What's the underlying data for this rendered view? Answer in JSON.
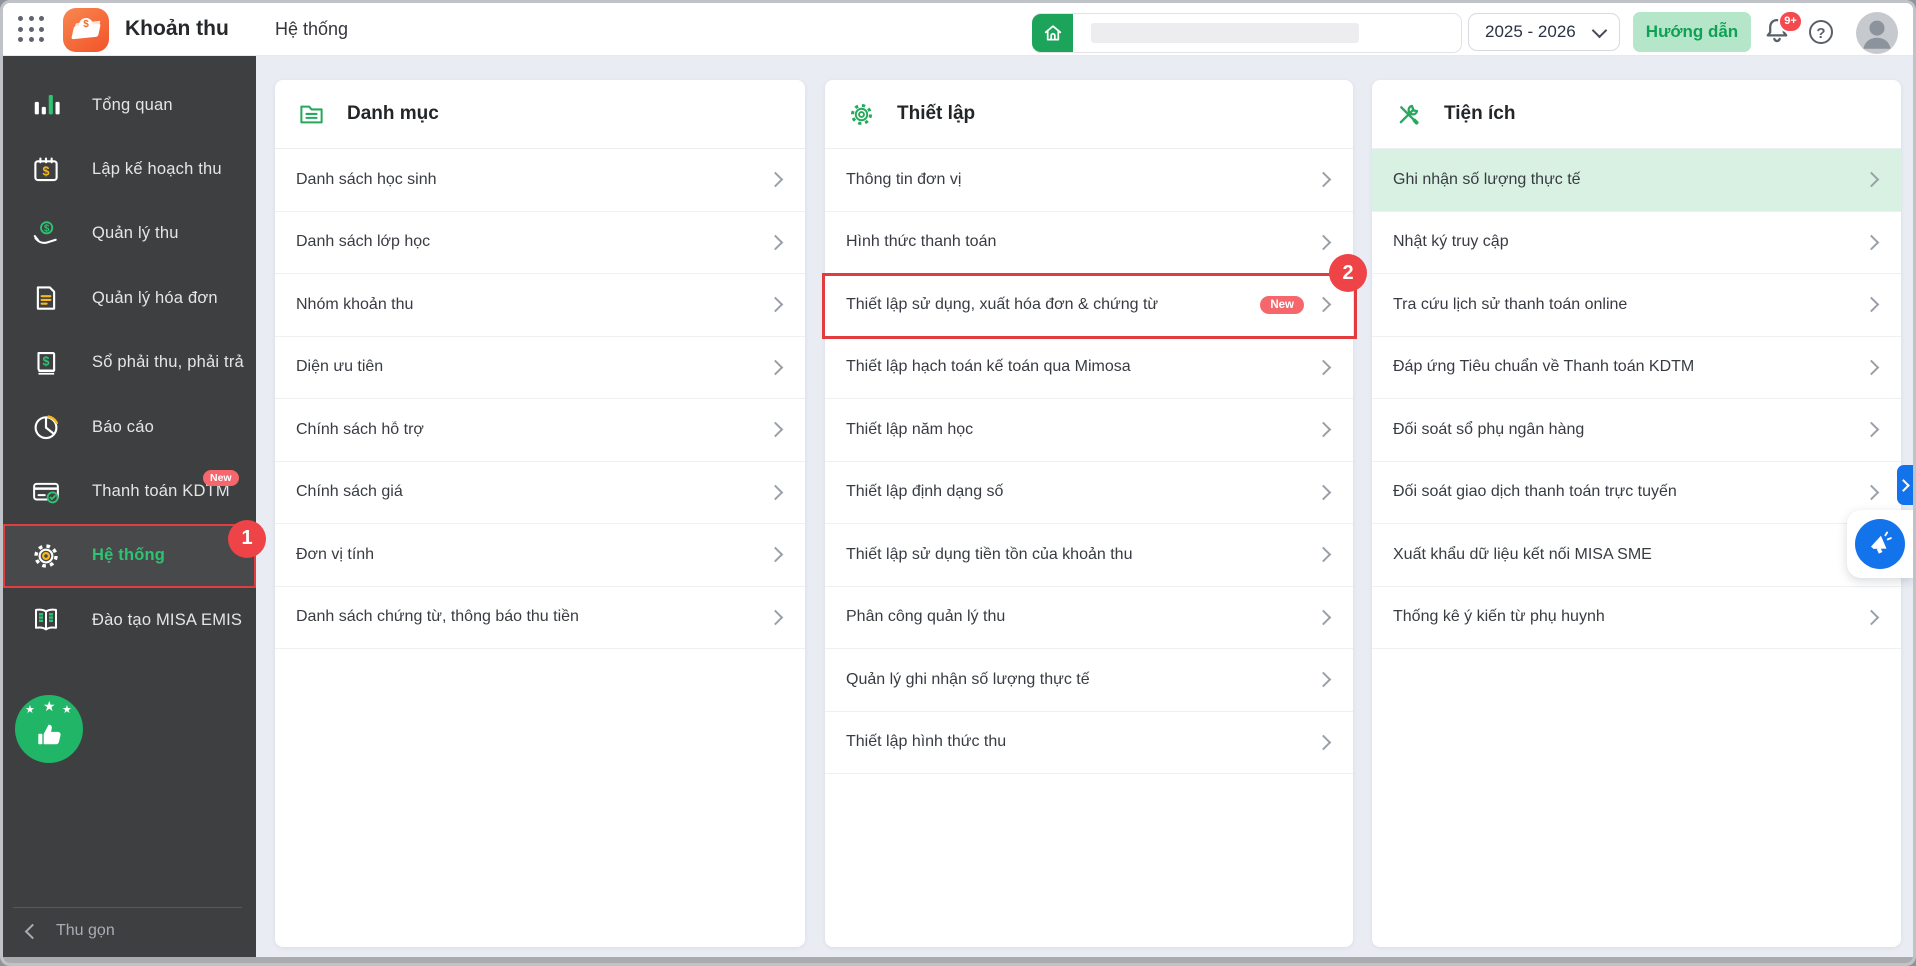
{
  "app": {
    "title": "Khoản thu",
    "breadcrumb": "Hệ thống"
  },
  "topbar": {
    "year_selector": "2025 - 2026",
    "guide_button": "Hướng dẫn",
    "notification_badge": "9+",
    "help_glyph": "?"
  },
  "sidebar": {
    "items": [
      {
        "label": "Tổng quan",
        "icon": "bar-chart-icon"
      },
      {
        "label": "Lập kế hoạch thu",
        "icon": "calendar-dollar-icon"
      },
      {
        "label": "Quản lý thu",
        "icon": "hand-coin-icon"
      },
      {
        "label": "Quản lý hóa đơn",
        "icon": "invoice-icon"
      },
      {
        "label": "Sổ phải thu, phải trả",
        "icon": "ledger-book-icon"
      },
      {
        "label": "Báo cáo",
        "icon": "pie-chart-icon"
      },
      {
        "label": "Thanh toán KDTM",
        "icon": "card-check-icon",
        "badge": "New"
      },
      {
        "label": "Hệ thống",
        "icon": "gear-icon",
        "active": true,
        "step_marker": "1"
      },
      {
        "label": "Đào tạo MISA EMIS",
        "icon": "open-book-icon"
      }
    ],
    "collapse_label": "Thu gọn"
  },
  "cards": [
    {
      "title": "Danh mục",
      "icon": "folder-list-icon",
      "items": [
        {
          "label": "Danh sách học sinh"
        },
        {
          "label": "Danh sách lớp học"
        },
        {
          "label": "Nhóm khoản thu"
        },
        {
          "label": "Diện ưu tiên"
        },
        {
          "label": "Chính sách hỗ trợ"
        },
        {
          "label": "Chính sách giá"
        },
        {
          "label": "Đơn vị tính"
        },
        {
          "label": "Danh sách chứng từ, thông báo thu tiền"
        }
      ]
    },
    {
      "title": "Thiết lập",
      "icon": "gear-outline-icon",
      "items": [
        {
          "label": "Thông tin đơn vị"
        },
        {
          "label": "Hình thức thanh toán"
        },
        {
          "label": "Thiết lập sử dụng, xuất hóa đơn & chứng từ",
          "badge": "New",
          "step_marker": "2",
          "highlight_red": true
        },
        {
          "label": "Thiết lập hạch toán kế toán qua Mimosa"
        },
        {
          "label": "Thiết lập năm học"
        },
        {
          "label": "Thiết lập định dạng số"
        },
        {
          "label": "Thiết lập sử dụng tiền tồn của khoản thu"
        },
        {
          "label": "Phân công quản lý thu"
        },
        {
          "label": "Quản lý ghi nhận số lượng thực tế"
        },
        {
          "label": "Thiết lập hình thức thu"
        }
      ]
    },
    {
      "title": "Tiện ích",
      "icon": "tools-icon",
      "items": [
        {
          "label": "Ghi nhận số lượng thực tế",
          "highlight_green": true
        },
        {
          "label": "Nhật ký truy cập"
        },
        {
          "label": "Tra cứu lịch sử thanh toán online"
        },
        {
          "label": "Đáp ứng Tiêu chuẩn về Thanh toán KDTM"
        },
        {
          "label": "Đối soát sổ phụ ngân hàng"
        },
        {
          "label": "Đối soát giao dịch thanh toán trực tuyến"
        },
        {
          "label": "Xuất khẩu dữ liệu kết nối MISA SME"
        },
        {
          "label": "Thống kê ý kiến từ phụ huynh"
        }
      ]
    }
  ],
  "colors": {
    "accent_green": "#1ca45b",
    "highlight_green_bg": "#d8f1e2",
    "marker_red": "#ee4347",
    "badge_pink": "#f5666d",
    "blue": "#1273eb",
    "sidebar_bg": "#3e3f41"
  }
}
